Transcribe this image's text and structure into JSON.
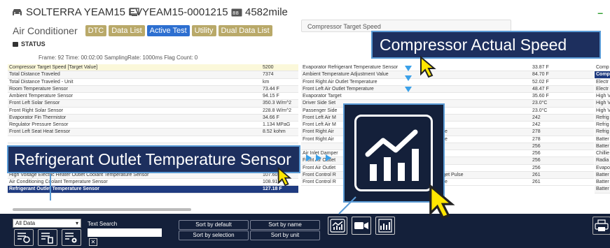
{
  "header": {
    "vehicle": "SOLTERRA YEAM15 EV",
    "vin": "YEAM15-0001215",
    "mileage": "4582mile",
    "right_mark": "–"
  },
  "tabs": {
    "title": "Air Conditioner",
    "items": [
      "DTC",
      "Data List",
      "Active Test",
      "Utility",
      "Dual Data List"
    ],
    "active": "Active Test"
  },
  "status": {
    "label": "STATUS",
    "frame_line": "Frame:  92    Time:  00:02:00    SamplingRate:  1000ms    Flag Count:  0"
  },
  "target_button": {
    "label": "Compressor Target Speed"
  },
  "left_table": [
    {
      "name": "Compressor Target Speed [Target Value]",
      "value": "5200",
      "style": "hl"
    },
    {
      "name": "Total Distance Traveled",
      "value": "7374"
    },
    {
      "name": "Total Distance Traveled - Unit",
      "value": "km"
    },
    {
      "name": "Room Temperature Sensor",
      "value": "73.44 F"
    },
    {
      "name": "Ambient Temperature Sensor",
      "value": "94.15 F"
    },
    {
      "name": "Front Left Solar Sensor",
      "value": "350.3 W/m^2"
    },
    {
      "name": "Front Right Solar Sensor",
      "value": "228.8 W/m^2"
    },
    {
      "name": "Evaporator Fin Thermistor",
      "value": "34.66 F"
    },
    {
      "name": "Regulator Pressure Sensor",
      "value": "1.134 MPaG"
    },
    {
      "name": "Front Left Seat Heat Sensor",
      "value": "8.52 kohm"
    },
    {
      "name": "",
      "value": ""
    },
    {
      "name": "",
      "value": ""
    },
    {
      "name": "",
      "value": ""
    },
    {
      "name": "",
      "value": ""
    },
    {
      "name": "High Voltage Electric Heater Outlet Coolant Temperature Sensor",
      "value": "107.60 F"
    },
    {
      "name": "High Voltage Electric Heater Outlet Coolant Temperature Sensor",
      "value": "107.60 F"
    },
    {
      "name": "Air Conditioning Coolant Temperature Sensor",
      "value": "108.91 F"
    },
    {
      "name": "Refrigerant Outlet Temperature Sensor",
      "value": "127.18 F",
      "style": "sel"
    }
  ],
  "mid_table": [
    {
      "name": "Evaporator Refrigerant Temperature Sensor",
      "value": "33.87 F"
    },
    {
      "name": "Ambient Temperature Adjustment Value",
      "value": "84.70 F"
    },
    {
      "name": "Front Right Air Outlet Temperature",
      "value": "52.02 F"
    },
    {
      "name": "Front Left Air Outlet Temperature",
      "value": "48.47 F"
    },
    {
      "name": "Evaporator Target",
      "value": "35.60 F"
    },
    {
      "name": "Driver Side Set",
      "value": "23.0°C"
    },
    {
      "name": "Passenger Side",
      "value": "23.0°C"
    },
    {
      "name": "Front Left Air M",
      "value": "242"
    },
    {
      "name": "Front Left Air M",
      "value": "242"
    },
    {
      "name": "Front Right Air",
      "value": "278"
    },
    {
      "name": "Front Right Air",
      "value": "278"
    },
    {
      "name": "",
      "value": "256"
    },
    {
      "name": "Air Inlet Damper",
      "value": "256"
    },
    {
      "name": "Front Air Outlet",
      "value": "256"
    },
    {
      "name": "Front Air Outlet",
      "value": "256"
    },
    {
      "name": "Front Control R",
      "value": "261"
    },
    {
      "name": "Front Control R",
      "value": "261"
    }
  ],
  "mid_table_suffix": {
    "r9": "lse",
    "r10": "lse",
    "r15": "rget Pulse",
    "r16": "lse"
  },
  "right_table": [
    "Comp",
    "Comp",
    "Electr",
    "Electr",
    "High V",
    "High V",
    "High V",
    "Refrig",
    "Refrig",
    "Refrig",
    "Batter",
    "Batter",
    "Chillie",
    "Radia",
    "Evapo",
    "Batter",
    "Batter",
    "Batter"
  ],
  "callouts": {
    "top": "Compressor Actual Speed",
    "left": "Refrigerant Outlet Temperature Sensor"
  },
  "footer": {
    "filter_value": "All Data",
    "text_search_label": "Text Search",
    "sort_default": "Sort by default",
    "sort_name": "Sort by name",
    "sort_selection": "Sort by selection",
    "sort_unit": "Sort by unit",
    "clear_mark": "✕"
  },
  "colors": {
    "footer_bg": "#14203a",
    "callout_bg": "#1d2f5e",
    "callout_border": "#5a9bd6",
    "active_tab": "#2d6fd0",
    "tab": "#b9a969",
    "selected_row": "#1f3b80"
  }
}
